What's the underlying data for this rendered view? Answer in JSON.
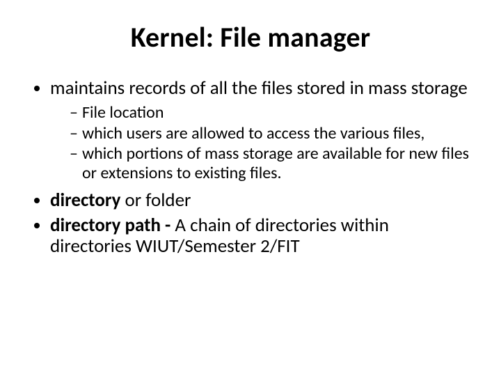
{
  "title": "Kernel: File manager",
  "bullets": {
    "b1": "maintains records of all the files stored in mass storage",
    "sub": {
      "s1": "File location",
      "s2": "which users are allowed to access the various files,",
      "s3": "which portions of mass storage are available for new files or extensions to existing files."
    },
    "b2_bold": "directory",
    "b2_rest": " or folder",
    "b3_bold": "directory path - ",
    "b3_rest": "A chain of directories within directories WIUT/Semester 2/FIT"
  }
}
